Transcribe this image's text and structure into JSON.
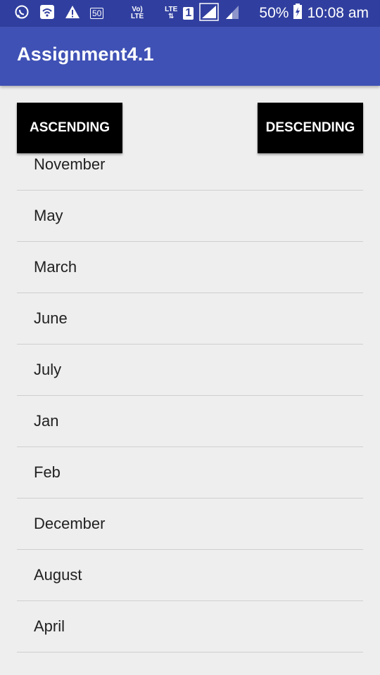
{
  "statusbar": {
    "small_label_1": "50",
    "volte_top": "Vo)",
    "volte_bottom": "LTE",
    "lte_label": "LTE",
    "sim_number": "1",
    "battery": "50%",
    "time": "10:08 am"
  },
  "appbar": {
    "title": "Assignment4.1"
  },
  "buttons": {
    "ascending": "ASCENDING",
    "descending": "DESCENDING"
  },
  "list": {
    "items": [
      "November",
      "May",
      "March",
      "June",
      "July",
      "Jan",
      "Feb",
      "December",
      "August",
      "April"
    ]
  },
  "colors": {
    "statusbar": "#303f9f",
    "appbar": "#3f51b5",
    "background": "#eeeeee",
    "button": "#000000"
  }
}
